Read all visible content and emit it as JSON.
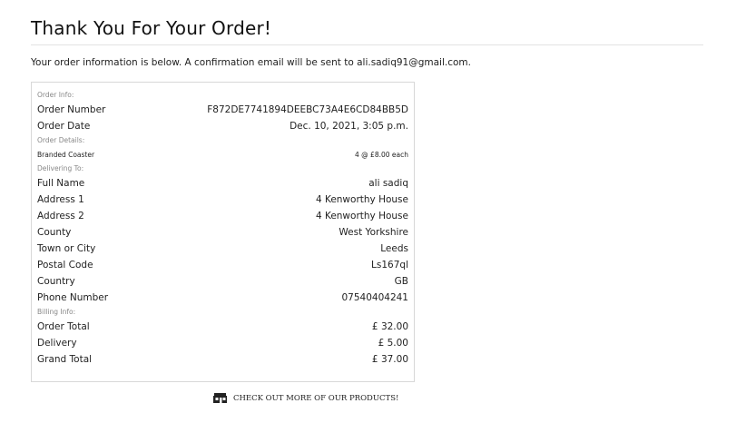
{
  "page": {
    "title": "Thank You For Your Order!",
    "intro": "Your order information is below. A confirmation email will be sent to ali.sadiq91@gmail.com."
  },
  "order_info": {
    "label": "Order Info:",
    "order_number_label": "Order Number",
    "order_number": "F872DE7741894DEEBC73A4E6CD84BB5D",
    "order_date_label": "Order Date",
    "order_date": "Dec. 10, 2021, 3:05 p.m."
  },
  "order_details": {
    "label": "Order Details:",
    "items": [
      {
        "name": "Branded Coaster",
        "qty_price": "4 @ £8.00 each"
      }
    ]
  },
  "delivering_to": {
    "label": "Delivering To:",
    "rows": [
      {
        "label": "Full Name",
        "value": "ali sadiq"
      },
      {
        "label": "Address 1",
        "value": "4 Kenworthy House"
      },
      {
        "label": "Address 2",
        "value": "4 Kenworthy House"
      },
      {
        "label": "County",
        "value": "West Yorkshire"
      },
      {
        "label": "Town or City",
        "value": "Leeds"
      },
      {
        "label": "Postal Code",
        "value": "Ls167ql"
      },
      {
        "label": "Country",
        "value": "GB"
      },
      {
        "label": "Phone Number",
        "value": "07540404241"
      }
    ]
  },
  "billing_info": {
    "label": "Billing Info:",
    "rows": [
      {
        "label": "Order Total",
        "value": "£ 32.00"
      },
      {
        "label": "Delivery",
        "value": "£ 5.00"
      },
      {
        "label": "Grand Total",
        "value": "£ 37.00"
      }
    ]
  },
  "cta": {
    "label": "CHECK OUT MORE OF OUR PRODUCTS!",
    "icon": "store-icon"
  }
}
